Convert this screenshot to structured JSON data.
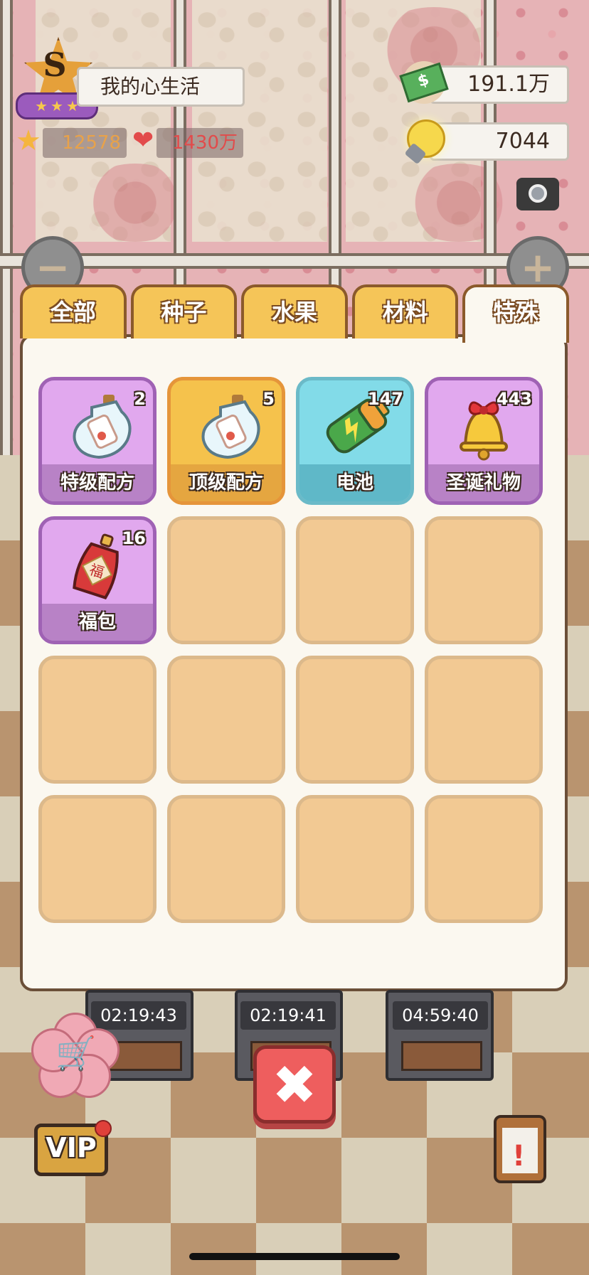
{
  "hud": {
    "rank_letter": "S",
    "rank_stars": [
      "★",
      "★",
      "★"
    ],
    "player_name": "我的心生活",
    "stars_count": "12578",
    "fans_count": "1430万",
    "money": "191.1万",
    "ideas": "7044",
    "money_symbol": "$",
    "icons": [
      "star-icon",
      "heart-fan-icon",
      "money-icon",
      "lightbulb-icon",
      "camera-icon",
      "zoom-out-icon",
      "zoom-in-icon"
    ]
  },
  "zoom": {
    "minus": "−",
    "plus": "+"
  },
  "tabs": [
    {
      "label": "全部",
      "active": false
    },
    {
      "label": "种子",
      "active": false
    },
    {
      "label": "水果",
      "active": false
    },
    {
      "label": "材料",
      "active": false
    },
    {
      "label": "特殊",
      "active": true
    }
  ],
  "items": [
    {
      "name": "特级配方",
      "count": "2",
      "style": "purple",
      "icon": "bottle-scroll-icon"
    },
    {
      "name": "顶级配方",
      "count": "5",
      "style": "gold",
      "icon": "bottle-scroll-icon"
    },
    {
      "name": "电池",
      "count": "147",
      "style": "cyan",
      "icon": "battery-icon"
    },
    {
      "name": "圣诞礼物",
      "count": "443",
      "style": "purple",
      "icon": "bell-icon"
    },
    {
      "name": "福包",
      "count": "16",
      "style": "purple",
      "icon": "lucky-bag-icon"
    }
  ],
  "empty_slots": 11,
  "machines": [
    {
      "timer": "02:19:43"
    },
    {
      "timer": "02:19:41"
    },
    {
      "timer": "04:59:40"
    }
  ],
  "bottom": {
    "close": "✖",
    "vip_label": "VIP",
    "shop_icon": "shopping-cart-icon",
    "tasks_icon": "clipboard-alert-icon"
  },
  "colors": {
    "tab": "#f5c558",
    "panel": "#fbf8f0",
    "slot_empty": "#f2c993",
    "slot_purple": "#e1a8ee",
    "slot_gold": "#f5c24c",
    "slot_cyan": "#82dbe8",
    "close_button": "#ee5e5e",
    "stars_text": "#e8a24a",
    "fans_text": "#e24b4b"
  }
}
